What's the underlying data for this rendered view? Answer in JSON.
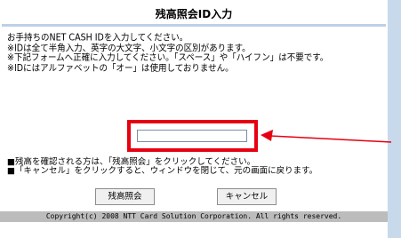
{
  "page": {
    "title": "残高照会ID入力"
  },
  "instructions": [
    "お手持ちのNET CASH IDを入力してください。",
    "※IDは全て半角入力、英字の大文字、小文字の区別があります。",
    "※下記フォームへ正確に入力してください。「スペース」や「ハイフン」は不要です。",
    "※IDにはアルファベットの「オー」は使用しておりません。"
  ],
  "id_input": {
    "value": "",
    "placeholder": ""
  },
  "notes": [
    "■残高を確認される方は、「残高照会」をクリックしてください。",
    "■「キャンセル」をクリックすると、ウィンドウを閉じて、元の画面に戻ります。"
  ],
  "buttons": {
    "balance_inquiry": "残高照会",
    "cancel": "キャンセル"
  },
  "footer": {
    "copyright": "Copyright(c) 2008 NTT Card Solution Corporation. All rights reserved."
  },
  "colors": {
    "highlight": "#e60012",
    "background": "#d3e2f0"
  }
}
